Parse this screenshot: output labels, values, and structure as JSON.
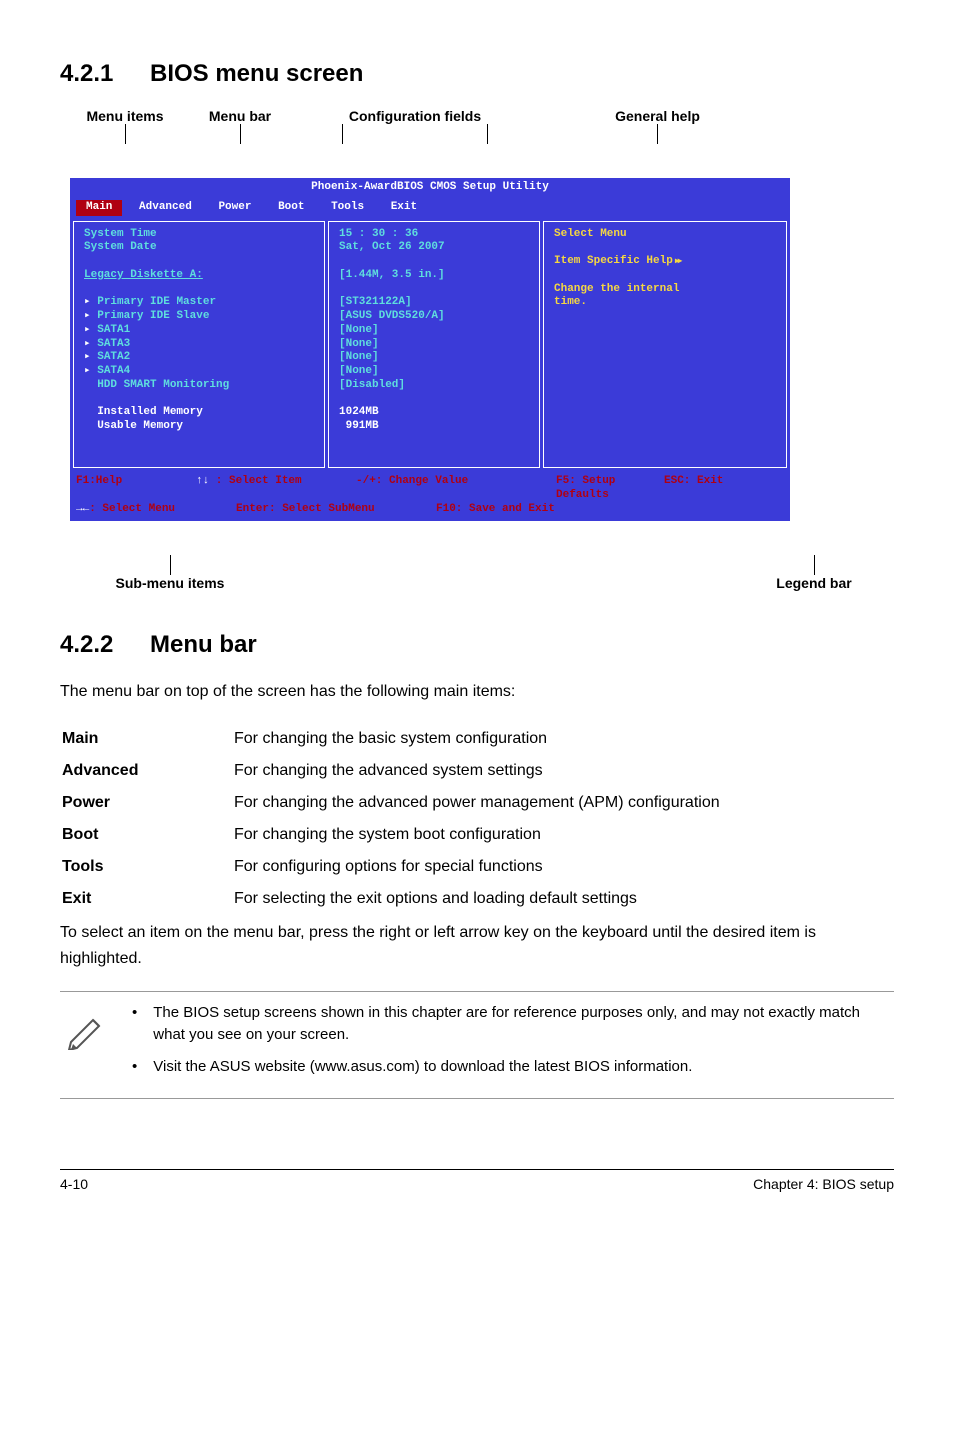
{
  "sections": {
    "s1": {
      "num": "4.2.1",
      "title": "BIOS menu screen"
    },
    "s2": {
      "num": "4.2.2",
      "title": "Menu bar"
    }
  },
  "top_labels": {
    "menu_items": "Menu items",
    "menu_bar": "Menu bar",
    "config_fields": "Configuration fields",
    "general_help": "General help"
  },
  "bot_labels": {
    "submenu": "Sub-menu items",
    "legend": "Legend bar"
  },
  "bios": {
    "header": "Phoenix-AwardBIOS CMOS Setup Utility",
    "tabs": [
      "Main",
      "Advanced",
      "Power",
      "Boot",
      "Tools",
      "Exit"
    ],
    "left": {
      "sys_time": "System Time",
      "sys_date": "System Date",
      "legacy": "Legacy Diskette A:",
      "items": [
        "Primary IDE Master",
        "Primary IDE Slave",
        "SATA1",
        "SATA3",
        "SATA2",
        "SATA4",
        "HDD SMART Monitoring"
      ],
      "inst_mem": "Installed Memory",
      "usable_mem": "Usable Memory"
    },
    "mid": {
      "time": "15 : 30 : 36",
      "date": "Sat, Oct 26 2007",
      "legacy_val": "[1.44M, 3.5 in.]",
      "vals": [
        "[ST321122A]",
        "[ASUS DVDS520/A]",
        "[None]",
        "[None]",
        "[None]",
        "[None]",
        "[Disabled]"
      ],
      "inst_mem_val": "1024MB",
      "usable_mem_val": " 991MB"
    },
    "right": {
      "select_menu": "Select Menu",
      "item_help": "Item Specific Help",
      "change1": "Change the internal",
      "change2": "time."
    },
    "footer": {
      "f1": "F1:Help",
      "sel_item": " : Select Item",
      "change_val": "-/+: Change Value",
      "f5": "F5: Setup Defaults",
      "esc": "ESC: Exit",
      "sel_menu": ": Select Menu",
      "enter_sel": "Enter: Select SubMenu",
      "f10": "F10: Save and Exit"
    }
  },
  "s2_intro": "The menu bar on top of the screen has the following main items:",
  "desc": {
    "Main": "For changing the basic system configuration",
    "Advanced": "For changing the advanced system settings",
    "Power": "For changing the advanced power management (APM) configuration",
    "Boot": "For changing the system boot configuration",
    "Tools": "For configuring options for special functions",
    "Exit": "For selecting the exit options and loading default settings"
  },
  "s2_outro": "To select an item on the menu bar, press the right or left arrow key on the keyboard until the desired item is highlighted.",
  "notes": [
    "The BIOS setup screens shown in this chapter are for reference purposes only, and may not exactly match what you see on your screen.",
    "Visit the ASUS website (www.asus.com) to download the latest BIOS information."
  ],
  "footer": {
    "left": "4-10",
    "right": "Chapter 4: BIOS setup"
  }
}
